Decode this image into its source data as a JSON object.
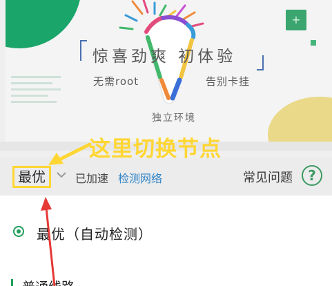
{
  "banner": {
    "slogan": "惊喜劲爽  初体验",
    "tagline_left": "无需root",
    "tagline_right": "告别卡挂",
    "badge": "独立环境",
    "plus_label": "+"
  },
  "annotation": {
    "text": "这里切换节点",
    "color": "#ffd632"
  },
  "speed_bar": {
    "node_selected": "最优",
    "status": "已加速",
    "detect_link": "检测网络",
    "faq": "常见问题",
    "help_glyph": "?",
    "accent_color": "#3d9a63",
    "link_color": "#2f84c8"
  },
  "node_list": {
    "options": [
      {
        "label": "最优（自动检测）",
        "selected": true
      }
    ],
    "section_header": "普通线路"
  },
  "icons": [
    "plus-icon",
    "chevron-down-icon",
    "help-icon",
    "radio-selected-icon",
    "annotation-arrow-icon",
    "red-arrow-icon"
  ]
}
